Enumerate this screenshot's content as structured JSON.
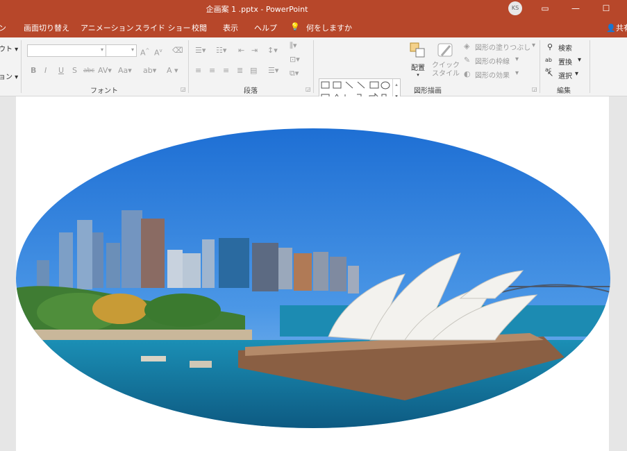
{
  "titlebar": {
    "title": "企画案 1 .pptx  -  PowerPoint",
    "avatar_initials": "KS",
    "color": "#b7472a"
  },
  "tabs": [
    {
      "label": "ン"
    },
    {
      "label": "画面切り替え"
    },
    {
      "label": "アニメーション"
    },
    {
      "label": "スライド ショー"
    },
    {
      "label": "校閲"
    },
    {
      "label": "表示"
    },
    {
      "label": "ヘルプ"
    },
    {
      "label": "何をしますか"
    }
  ],
  "share_label": "共有",
  "ribbon": {
    "left_partial": {
      "top": "ウト ▾",
      "bottom": "ョン ▾"
    },
    "font": {
      "group_label": "フォント"
    },
    "paragraph": {
      "group_label": "段落"
    },
    "drawing": {
      "group_label": "図形描画",
      "arrange_label": "配置",
      "quick_style_label_1": "クイック",
      "quick_style_label_2": "スタイル",
      "fill_label": "図形の塗りつぶし",
      "outline_label": "図形の枠線",
      "effects_label": "図形の効果"
    },
    "editing": {
      "group_label": "編集",
      "find_label": "検索",
      "replace_label": "置換",
      "select_label": "選択"
    }
  },
  "slide": {
    "image_description_icon": "opera-house-photo",
    "image_shape": "ellipse"
  }
}
